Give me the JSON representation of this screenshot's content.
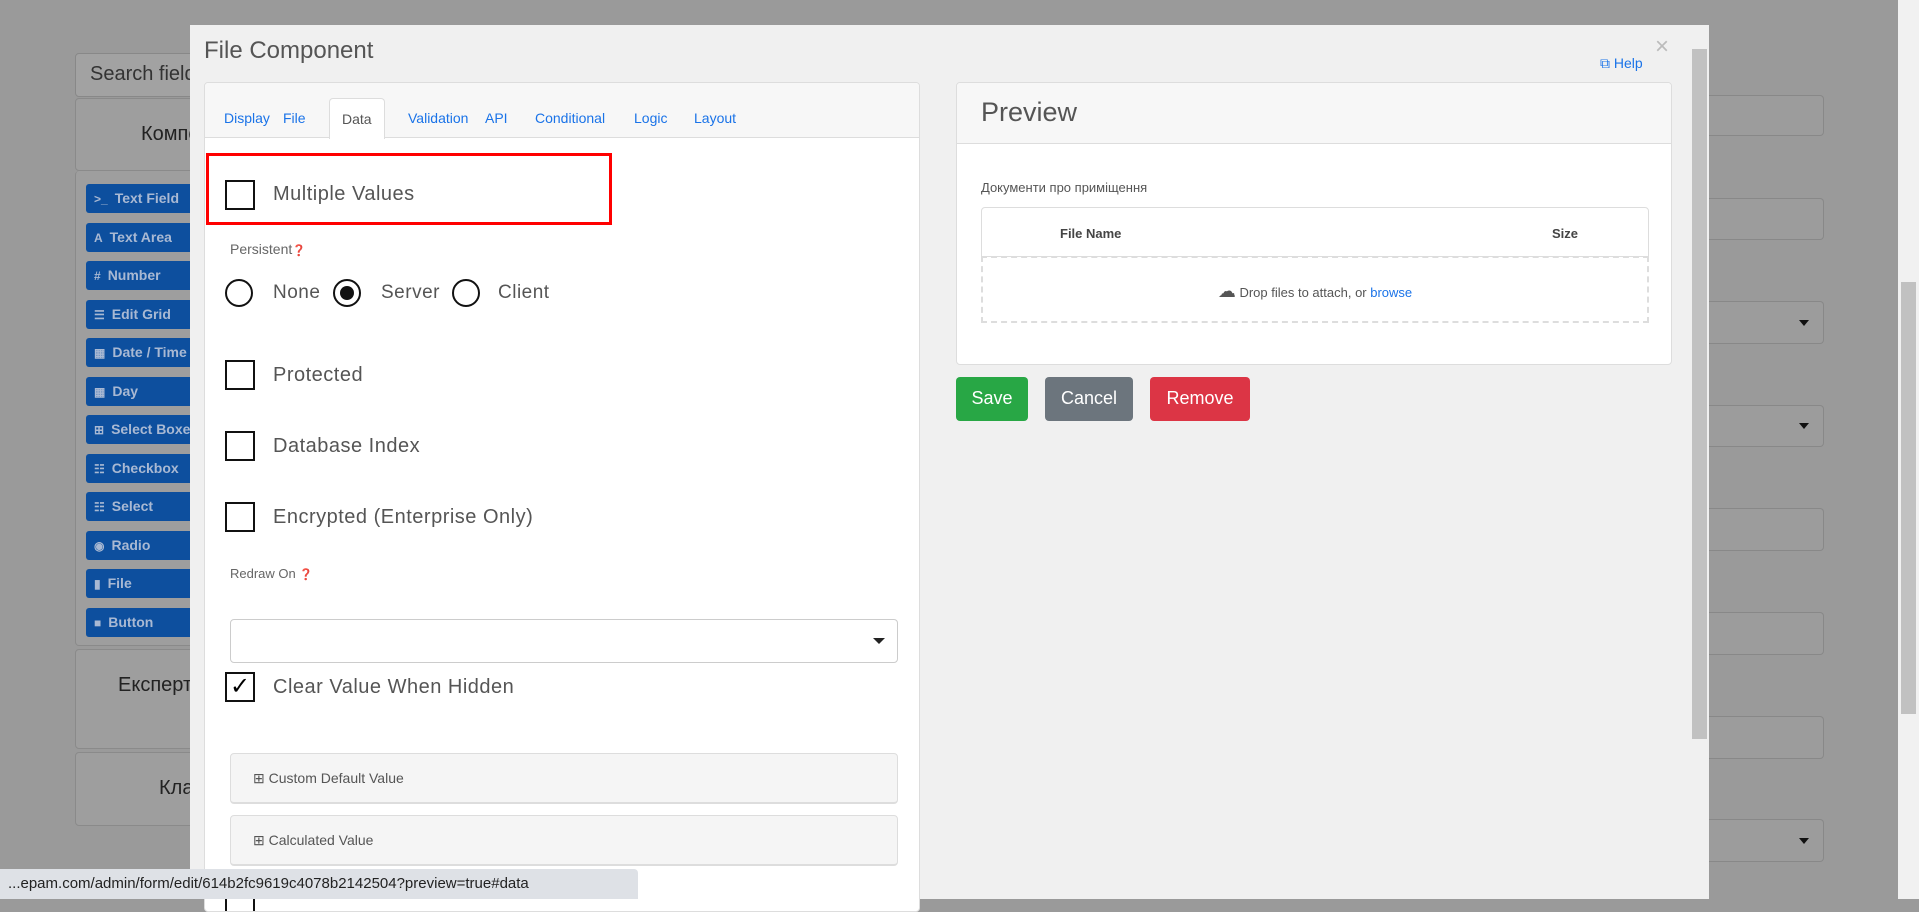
{
  "background": {
    "search_placeholder": "Search field(s)",
    "panels": [
      "Компоненти",
      "Експертні",
      "Класичні"
    ],
    "components": [
      {
        "icon": "terminal-icon",
        "glyph": ">_",
        "label": "Text Field"
      },
      {
        "icon": "font-icon",
        "glyph": "A",
        "label": "Text Area"
      },
      {
        "icon": "hash-icon",
        "glyph": "#",
        "label": "Number"
      },
      {
        "icon": "tasks-icon",
        "glyph": "☰",
        "label": "Edit Grid"
      },
      {
        "icon": "calendar-icon",
        "glyph": "▦",
        "label": "Date / Time"
      },
      {
        "icon": "calendar-icon",
        "glyph": "▦",
        "label": "Day"
      },
      {
        "icon": "plus-square-icon",
        "glyph": "⊞",
        "label": "Select Boxes"
      },
      {
        "icon": "th-list-icon",
        "glyph": "☷",
        "label": "Checkbox"
      },
      {
        "icon": "th-list-icon",
        "glyph": "☷",
        "label": "Select"
      },
      {
        "icon": "dot-circle-icon",
        "glyph": "◉",
        "label": "Radio"
      },
      {
        "icon": "file-icon",
        "glyph": "▮",
        "label": "File"
      },
      {
        "icon": "stop-icon",
        "glyph": "■",
        "label": "Button"
      }
    ]
  },
  "modal": {
    "title": "File Component",
    "help": "Help",
    "close": "×",
    "tabs": [
      "Display",
      "File",
      "Data",
      "Validation",
      "API",
      "Conditional",
      "Logic",
      "Layout"
    ],
    "active_tab": "Data",
    "highlight_color": "#ff0000",
    "fields": {
      "multiple_values": {
        "label": "Multiple Values",
        "checked": false
      },
      "persistent": {
        "label": "Persistent",
        "options": [
          "None",
          "Server",
          "Client"
        ],
        "selected": "Server"
      },
      "protected": {
        "label": "Protected",
        "checked": false
      },
      "database_index": {
        "label": "Database Index",
        "checked": false
      },
      "encrypted": {
        "label": "Encrypted (Enterprise Only)",
        "checked": false
      },
      "redraw_on": {
        "label": "Redraw On",
        "value": ""
      },
      "clear_value": {
        "label": "Clear Value When Hidden",
        "checked": true
      },
      "custom_default": "Custom Default Value",
      "calculated": "Calculated Value"
    },
    "preview": {
      "title": "Preview",
      "field_label": "Документи про приміщення",
      "col_name": "File Name",
      "col_size": "Size",
      "drop_text": "Drop files to attach, or",
      "browse": "browse"
    },
    "buttons": {
      "save": "Save",
      "cancel": "Cancel",
      "remove": "Remove"
    },
    "colors": {
      "save": "#28a745",
      "cancel": "#6c757d",
      "remove": "#dc3545",
      "link": "#1a73e8"
    }
  },
  "status_url": "...epam.com/admin/form/edit/614b2fc9619c4078b2142504?preview=true#data"
}
